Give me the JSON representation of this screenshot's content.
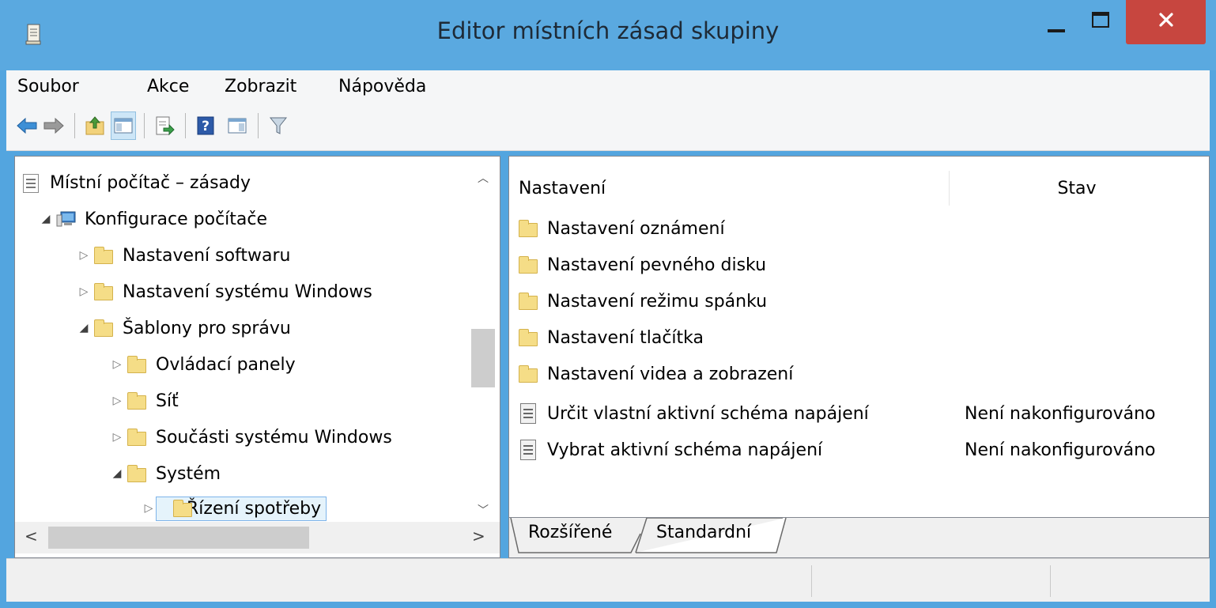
{
  "window": {
    "title": "Editor místních zásad skupiny",
    "icons": [
      "gpedit-app-icon",
      "minimize-icon",
      "maximize-icon",
      "close-icon"
    ],
    "colors": {
      "titlebar": "#5aa9e0",
      "close": "#c7463f",
      "selection": "#e5f3fb"
    }
  },
  "menu": {
    "items": [
      {
        "label": "Soubor"
      },
      {
        "label": "Akce"
      },
      {
        "label": "Zobrazit"
      },
      {
        "label": "Nápověda"
      }
    ]
  },
  "toolbar": {
    "buttons": [
      {
        "icon": "back-arrow-icon"
      },
      {
        "icon": "forward-arrow-icon"
      },
      {
        "icon": "up-folder-icon"
      },
      {
        "icon": "show-hide-tree-icon",
        "active": true
      },
      {
        "icon": "export-list-icon"
      },
      {
        "icon": "help-icon"
      },
      {
        "icon": "show-action-pane-icon"
      },
      {
        "icon": "filter-icon"
      }
    ]
  },
  "tree": {
    "items": [
      {
        "label": "Místní počítač – zásady",
        "icon": "policy-document-icon",
        "arrow": ""
      },
      {
        "label": "Konfigurace počítače",
        "icon": "computer-icon",
        "arrow": "◢"
      },
      {
        "label": "Nastavení softwaru",
        "icon": "folder-icon",
        "arrow": "▷"
      },
      {
        "label": "Nastavení systému Windows",
        "icon": "folder-icon",
        "arrow": "▷"
      },
      {
        "label": "Šablony pro správu",
        "icon": "folder-icon",
        "arrow": "◢"
      },
      {
        "label": "Ovládací panely",
        "icon": "folder-icon",
        "arrow": "▷"
      },
      {
        "label": "Síť",
        "icon": "folder-icon",
        "arrow": "▷"
      },
      {
        "label": "Součásti systému Windows",
        "icon": "folder-icon",
        "arrow": "▷"
      },
      {
        "label": "Systém",
        "icon": "folder-icon",
        "arrow": "◢"
      },
      {
        "label": "Řízení spotřeby",
        "icon": "folder-icon",
        "arrow": "▷",
        "selected": true
      }
    ]
  },
  "list": {
    "columns": {
      "setting": "Nastavení",
      "state": "Stav"
    },
    "rows": [
      {
        "name": "Nastavení oznámení",
        "state": "",
        "icon": "folder-icon"
      },
      {
        "name": "Nastavení pevného disku",
        "state": "",
        "icon": "folder-icon"
      },
      {
        "name": "Nastavení režimu spánku",
        "state": "",
        "icon": "folder-icon"
      },
      {
        "name": "Nastavení tlačítka",
        "state": "",
        "icon": "folder-icon"
      },
      {
        "name": "Nastavení videa a zobrazení",
        "state": "",
        "icon": "folder-icon"
      },
      {
        "name": "Určit vlastní aktivní schéma napájení",
        "state": "Není nakonfigurováno",
        "icon": "policy-setting-icon"
      },
      {
        "name": "Vybrat aktivní schéma napájení",
        "state": "Není nakonfigurováno",
        "icon": "policy-setting-icon"
      }
    ]
  },
  "tabs": [
    {
      "label": "Rozšířené"
    },
    {
      "label": "Standardní",
      "active": true
    }
  ]
}
